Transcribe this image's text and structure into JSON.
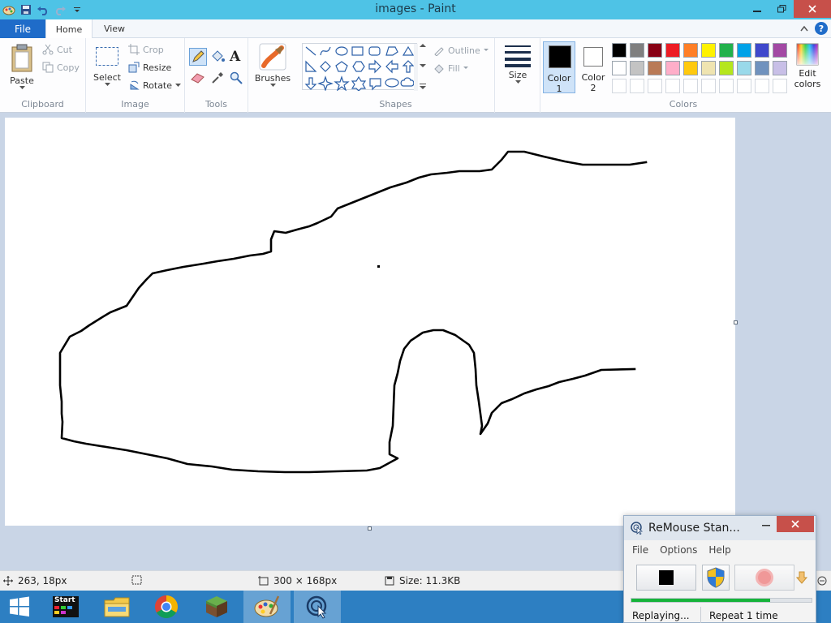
{
  "window": {
    "title": "images - Paint"
  },
  "tabs": {
    "file": "File",
    "home": "Home",
    "view": "View"
  },
  "clipboard": {
    "paste": "Paste",
    "cut": "Cut",
    "copy": "Copy",
    "label": "Clipboard"
  },
  "image": {
    "select": "Select",
    "crop": "Crop",
    "resize": "Resize",
    "rotate": "Rotate",
    "label": "Image"
  },
  "tools": {
    "label": "Tools",
    "text_glyph": "A"
  },
  "brushes": {
    "label": "Brushes"
  },
  "shapes": {
    "outline": "Outline",
    "fill": "Fill",
    "label": "Shapes"
  },
  "size": {
    "label": "Size"
  },
  "colors": {
    "color1_label": "Color",
    "color1_num": "1",
    "color2_label": "Color",
    "color2_num": "2",
    "label": "Colors",
    "edit_label1": "Edit",
    "edit_label2": "colors",
    "color1": "#000000",
    "color2": "#ffffff",
    "palette_row1": [
      "#000000",
      "#7f7f7f",
      "#880015",
      "#ed1c24",
      "#ff7f27",
      "#fff200",
      "#22b14c",
      "#00a2e8",
      "#3f48cc",
      "#a349a4"
    ],
    "palette_row2": [
      "#ffffff",
      "#c3c3c3",
      "#b97a57",
      "#ffaec9",
      "#ffc90e",
      "#efe4b0",
      "#b5e61d",
      "#99d9ea",
      "#7092be",
      "#c8bfe7"
    ]
  },
  "status": {
    "cursor_pos": "263, 18px",
    "dimensions": "300 × 168px",
    "size": "Size: 11.3KB"
  },
  "taskbar": {
    "start_label": "Start"
  },
  "remouse": {
    "title": "ReMouse Stan...",
    "menu": [
      "File",
      "Options",
      "Help"
    ],
    "progress": 0.77,
    "status_left": "Replaying...",
    "status_right": "Repeat 1 time"
  }
}
